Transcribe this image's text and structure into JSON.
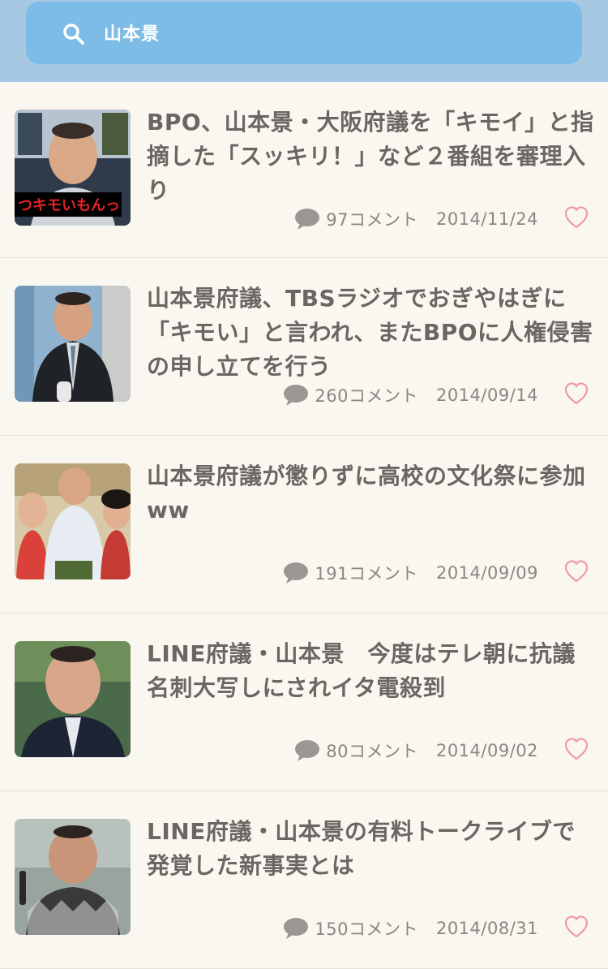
{
  "search": {
    "query": "山本景"
  },
  "articles": [
    {
      "title": "BPO、山本景・大阪府議を「キモイ」と指摘した「スッキリ！」など２番組を審理入り",
      "comments": "97コメント",
      "date": "2014/11/24",
      "thumb_caption": "つキモいもんっ"
    },
    {
      "title": "山本景府議、TBSラジオでおぎやはぎに「キモい」と言われ、またBPOに人権侵害の申し立てを行う",
      "comments": "260コメント",
      "date": "2014/09/14"
    },
    {
      "title": "山本景府議が懲りずに高校の文化祭に参加ww",
      "comments": "191コメント",
      "date": "2014/09/09"
    },
    {
      "title": "LINE府議・山本景　今度はテレ朝に抗議　名刺大写しにされイタ電殺到",
      "comments": "80コメント",
      "date": "2014/09/02"
    },
    {
      "title": "LINE府議・山本景の有料トークライブで発覚した新事実とは",
      "comments": "150コメント",
      "date": "2014/08/31"
    }
  ],
  "colors": {
    "header_bg": "#a6c8e3",
    "search_bg": "#7dbce6",
    "title_text": "#6a6662",
    "meta_text": "#8a8682",
    "heart": "#f19aa8",
    "page_bg": "#faf7f0"
  },
  "icons": {
    "search": "search-icon",
    "comment": "speech-bubble-icon",
    "favorite": "heart-icon"
  }
}
